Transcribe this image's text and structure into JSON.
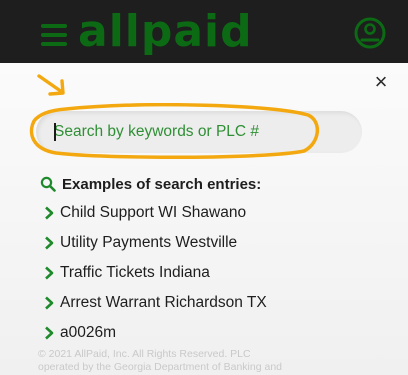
{
  "header": {
    "logo_text": "allpaid",
    "menu_icon": "hamburger-menu-icon",
    "account_icon": "account-icon",
    "brand_color": "#0c6a14"
  },
  "search": {
    "placeholder": "Search by keywords or PLC #",
    "close_label": "×"
  },
  "examples": {
    "title": "Examples of search entries:",
    "items": [
      "Child Support WI Shawano",
      "Utility Payments Westville",
      "Traffic Tickets Indiana",
      "Arrest Warrant Richardson TX",
      "a0026m"
    ]
  },
  "footer": {
    "line1": "© 2021 AllPaid, Inc. All Rights Reserved. PLC",
    "line2": "operated by the Georgia Department of Banking and"
  },
  "colors": {
    "highlight": "#f3a80f",
    "accent_green": "#1f8a2c"
  }
}
